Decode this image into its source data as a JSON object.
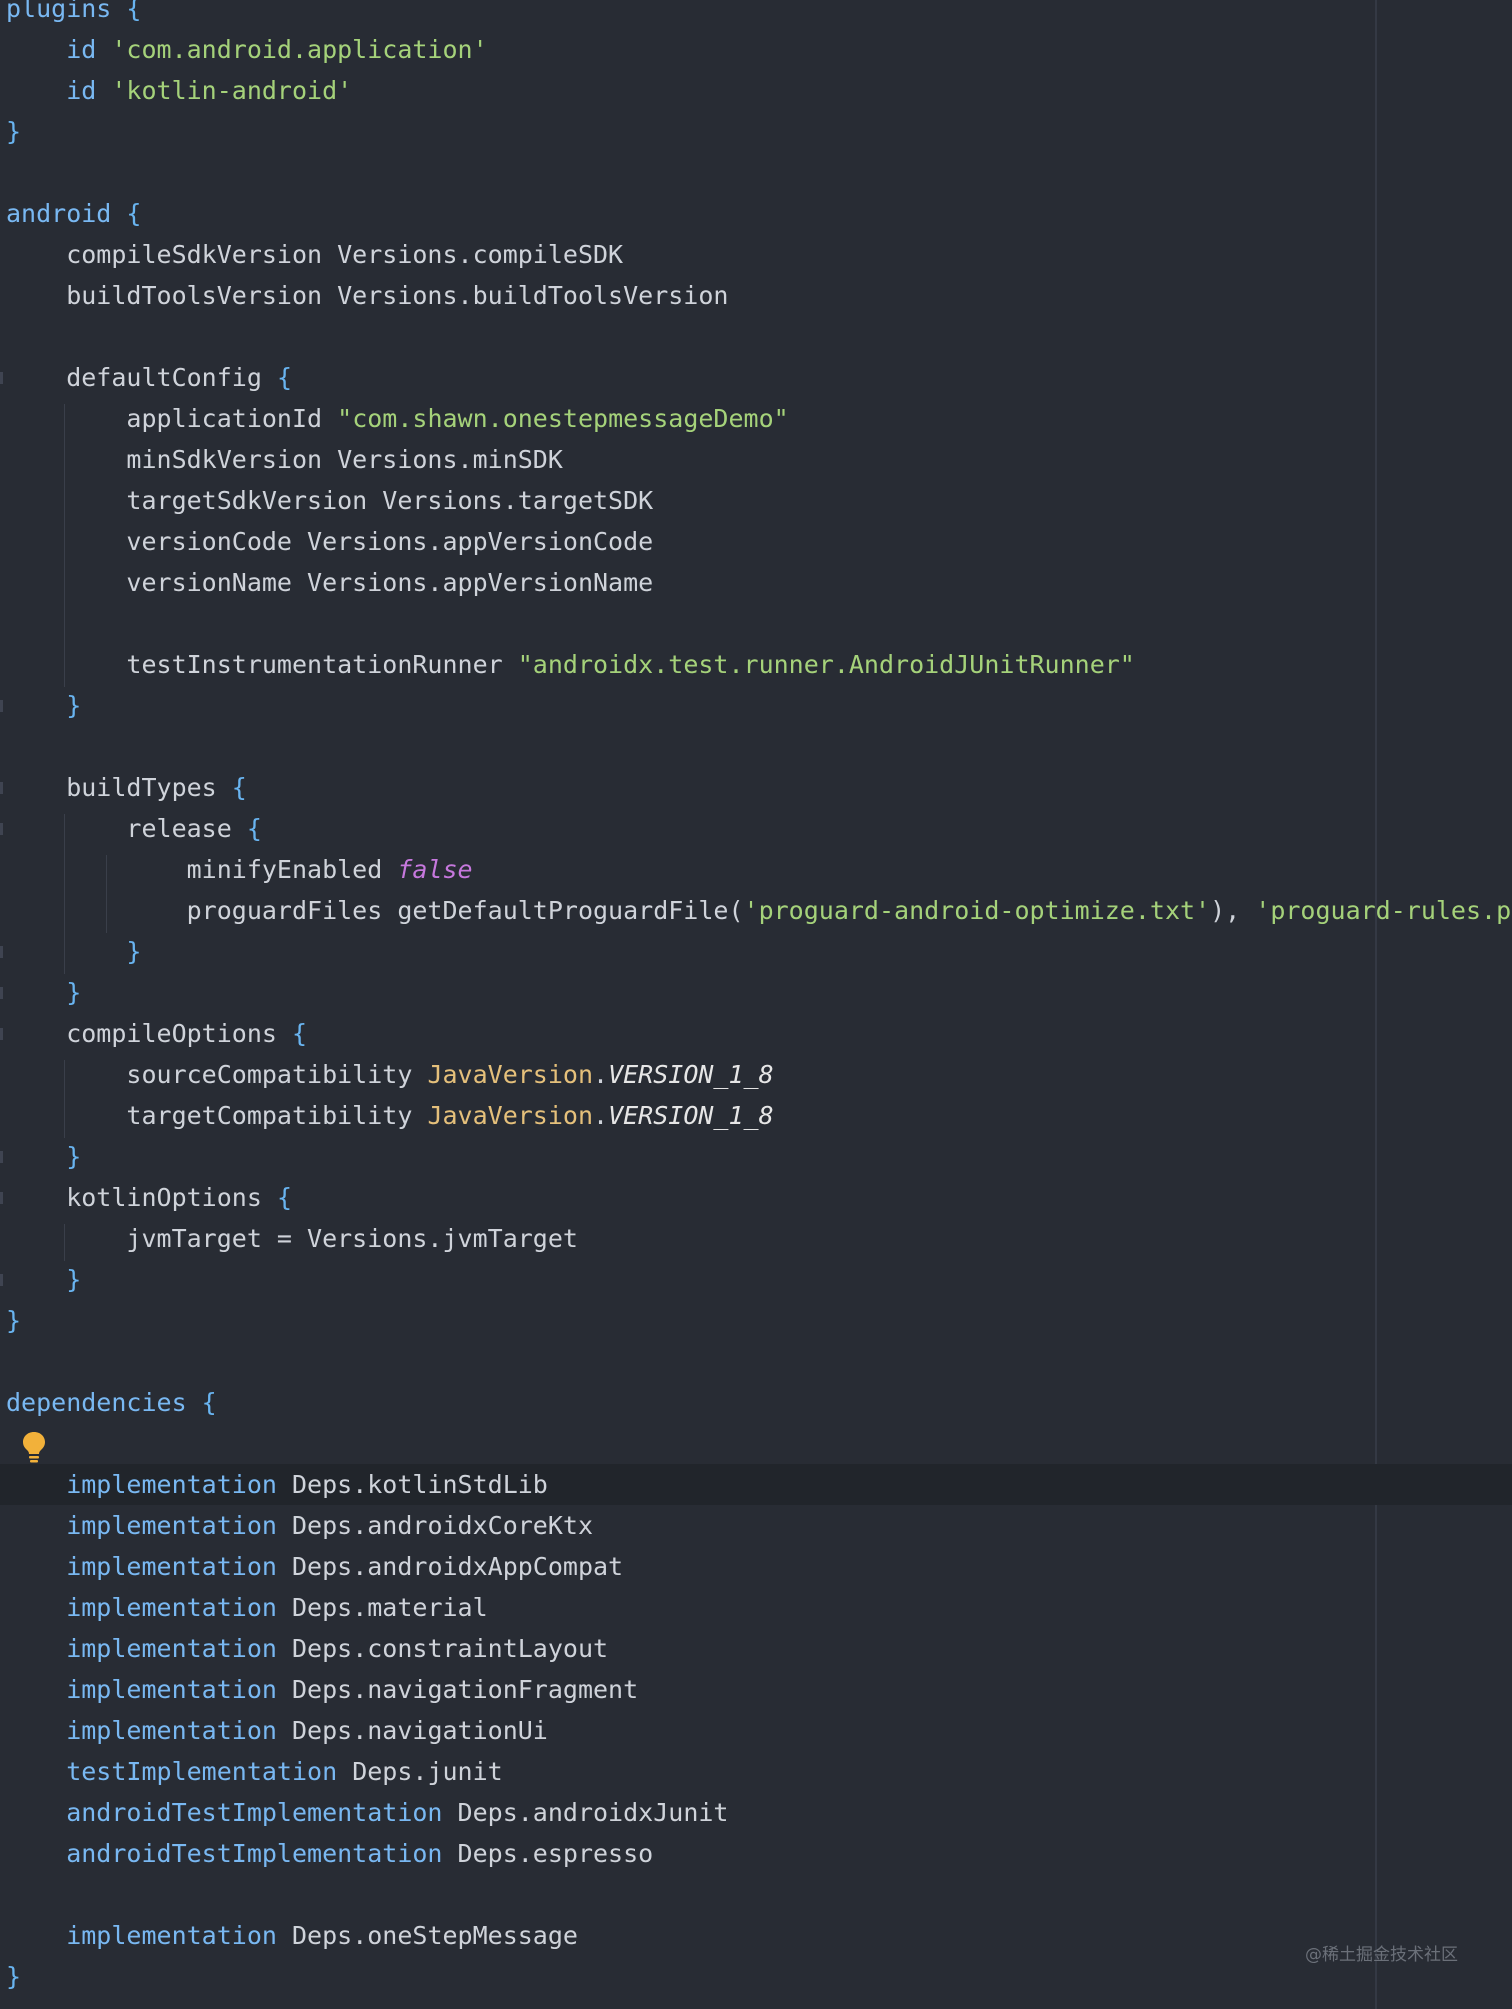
{
  "editor": {
    "language": "gradle",
    "lines": [
      [
        {
          "t": "plugins ",
          "c": "fn"
        },
        {
          "t": "{",
          "c": "brace"
        }
      ],
      [
        {
          "t": "    id ",
          "c": "fn"
        },
        {
          "t": "'com.android.application'",
          "c": "str"
        }
      ],
      [
        {
          "t": "    id ",
          "c": "fn"
        },
        {
          "t": "'kotlin-android'",
          "c": "str"
        }
      ],
      [
        {
          "t": "}",
          "c": "brace"
        }
      ],
      [],
      [
        {
          "t": "android ",
          "c": "fn"
        },
        {
          "t": "{",
          "c": "brace"
        }
      ],
      [
        {
          "t": "    compileSdkVersion Versions.compileSDK",
          "c": "plain"
        }
      ],
      [
        {
          "t": "    buildToolsVersion Versions.buildToolsVersion",
          "c": "plain"
        }
      ],
      [],
      [
        {
          "t": "    defaultConfig ",
          "c": "plain"
        },
        {
          "t": "{",
          "c": "brace"
        }
      ],
      [
        {
          "t": "        applicationId ",
          "c": "plain"
        },
        {
          "t": "\"com.shawn.onestepmessageDemo\"",
          "c": "str"
        }
      ],
      [
        {
          "t": "        minSdkVersion Versions.minSDK",
          "c": "plain"
        }
      ],
      [
        {
          "t": "        targetSdkVersion Versions.targetSDK",
          "c": "plain"
        }
      ],
      [
        {
          "t": "        versionCode Versions.appVersionCode",
          "c": "plain"
        }
      ],
      [
        {
          "t": "        versionName Versions.appVersionName",
          "c": "plain"
        }
      ],
      [],
      [
        {
          "t": "        testInstrumentationRunner ",
          "c": "plain"
        },
        {
          "t": "\"androidx.test.runner.AndroidJUnitRunner\"",
          "c": "str"
        }
      ],
      [
        {
          "t": "    }",
          "c": "brace"
        }
      ],
      [],
      [
        {
          "t": "    buildTypes ",
          "c": "plain"
        },
        {
          "t": "{",
          "c": "brace"
        }
      ],
      [
        {
          "t": "        release ",
          "c": "plain"
        },
        {
          "t": "{",
          "c": "brace"
        }
      ],
      [
        {
          "t": "            minifyEnabled ",
          "c": "plain"
        },
        {
          "t": "false",
          "c": "kw"
        }
      ],
      [
        {
          "t": "            proguardFiles getDefaultProguardFile(",
          "c": "plain"
        },
        {
          "t": "'proguard-android-optimize.txt'",
          "c": "str"
        },
        {
          "t": "), ",
          "c": "plain"
        },
        {
          "t": "'proguard-rules.pro'",
          "c": "str"
        }
      ],
      [
        {
          "t": "        }",
          "c": "brace"
        }
      ],
      [
        {
          "t": "    }",
          "c": "brace"
        }
      ],
      [
        {
          "t": "    compileOptions ",
          "c": "plain"
        },
        {
          "t": "{",
          "c": "brace"
        }
      ],
      [
        {
          "t": "        sourceCompatibility ",
          "c": "plain"
        },
        {
          "t": "JavaVersion",
          "c": "cls"
        },
        {
          "t": ".",
          "c": "plain"
        },
        {
          "t": "VERSION_1_8",
          "c": "const"
        }
      ],
      [
        {
          "t": "        targetCompatibility ",
          "c": "plain"
        },
        {
          "t": "JavaVersion",
          "c": "cls"
        },
        {
          "t": ".",
          "c": "plain"
        },
        {
          "t": "VERSION_1_8",
          "c": "const"
        }
      ],
      [
        {
          "t": "    }",
          "c": "brace"
        }
      ],
      [
        {
          "t": "    kotlinOptions ",
          "c": "plain"
        },
        {
          "t": "{",
          "c": "brace"
        }
      ],
      [
        {
          "t": "        jvmTarget = Versions.jvmTarget",
          "c": "plain"
        }
      ],
      [
        {
          "t": "    }",
          "c": "brace"
        }
      ],
      [
        {
          "t": "}",
          "c": "brace"
        }
      ],
      [],
      [
        {
          "t": "dependencies ",
          "c": "fn"
        },
        {
          "t": "{",
          "c": "brace"
        }
      ],
      [],
      [
        {
          "t": "    implementation ",
          "c": "fn"
        },
        {
          "t": "Deps.kotlinStdLib",
          "c": "plain"
        }
      ],
      [
        {
          "t": "    implementation ",
          "c": "fn"
        },
        {
          "t": "Deps.androidxCoreKtx",
          "c": "plain"
        }
      ],
      [
        {
          "t": "    implementation ",
          "c": "fn"
        },
        {
          "t": "Deps.androidxAppCompat",
          "c": "plain"
        }
      ],
      [
        {
          "t": "    implementation ",
          "c": "fn"
        },
        {
          "t": "Deps.material",
          "c": "plain"
        }
      ],
      [
        {
          "t": "    implementation ",
          "c": "fn"
        },
        {
          "t": "Deps.constraintLayout",
          "c": "plain"
        }
      ],
      [
        {
          "t": "    implementation ",
          "c": "fn"
        },
        {
          "t": "Deps.navigationFragment",
          "c": "plain"
        }
      ],
      [
        {
          "t": "    implementation ",
          "c": "fn"
        },
        {
          "t": "Deps.navigationUi",
          "c": "plain"
        }
      ],
      [
        {
          "t": "    testImplementation ",
          "c": "fn"
        },
        {
          "t": "Deps.junit",
          "c": "plain"
        }
      ],
      [
        {
          "t": "    androidTestImplementation ",
          "c": "fn"
        },
        {
          "t": "Deps.androidxJunit",
          "c": "plain"
        }
      ],
      [
        {
          "t": "    androidTestImplementation ",
          "c": "fn"
        },
        {
          "t": "Deps.espresso",
          "c": "plain"
        }
      ],
      [],
      [
        {
          "t": "    implementation ",
          "c": "fn"
        },
        {
          "t": "Deps.oneStepMessage",
          "c": "plain"
        }
      ],
      [
        {
          "t": "}",
          "c": "brace"
        }
      ]
    ],
    "current_line": 36,
    "intention_icon": "lightbulb-icon"
  },
  "colors": {
    "background": "#282c34",
    "current_line": "#21252b",
    "identifier": "#cfd3da",
    "method": "#79b8f2",
    "string": "#a5d27a",
    "class": "#e5c07b",
    "keyword": "#c678dd"
  },
  "watermark": "@稀土掘金技术社区"
}
